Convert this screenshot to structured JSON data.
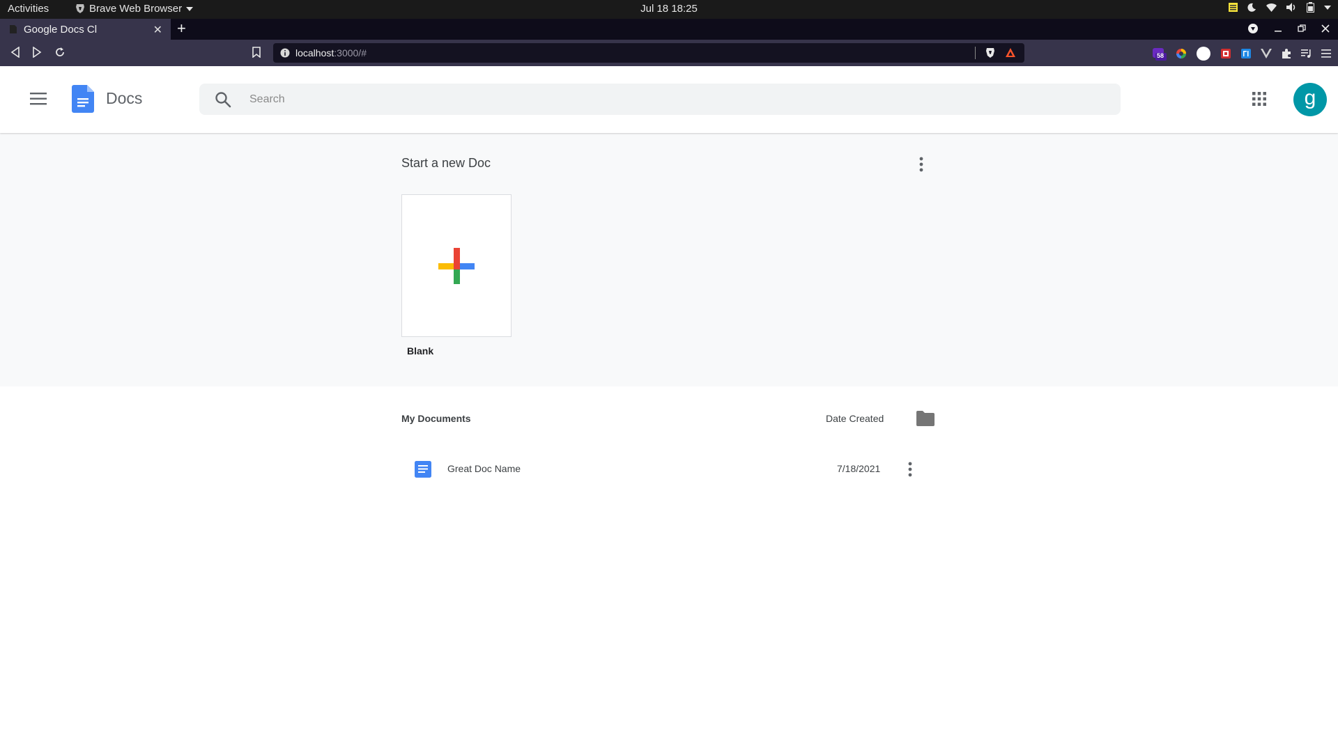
{
  "os": {
    "activities": "Activities",
    "app_name": "Brave Web Browser",
    "clock": "Jul 18  18:25"
  },
  "browser": {
    "tab_title": "Google Docs Cl",
    "url_host": "localhost",
    "url_rest": ":3000/#",
    "extension_badge": "58"
  },
  "header": {
    "app_title": "Docs",
    "search_placeholder": "Search",
    "avatar_letter": "g"
  },
  "templates": {
    "title": "Start a new Doc",
    "blank_label": "Blank"
  },
  "documents": {
    "title": "My Documents",
    "date_column": "Date Created",
    "items": [
      {
        "name": "Great Doc Name",
        "date": "7/18/2021"
      }
    ]
  },
  "colors": {
    "brand_blue": "#4285f4",
    "avatar_bg": "#0097a7",
    "plus_red": "#ea4335",
    "plus_blue": "#4285f4",
    "plus_green": "#34a853",
    "plus_yellow": "#fbbc04"
  }
}
